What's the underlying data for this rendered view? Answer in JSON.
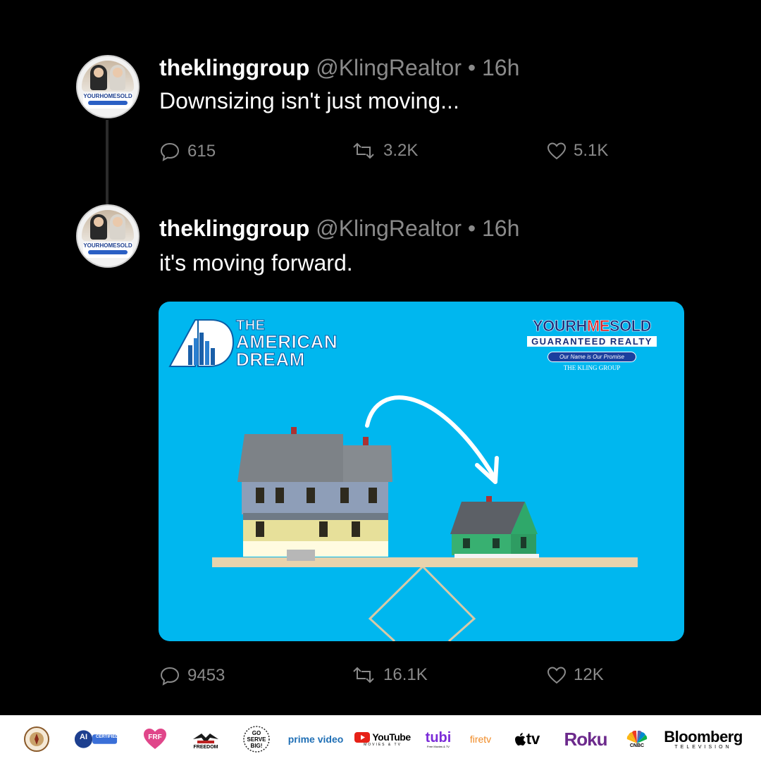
{
  "tweets": [
    {
      "display_name": "theklinggroup",
      "meta": "@KlingRealtor • 16h",
      "text": "Downsizing isn't just moving...",
      "replies": "615",
      "retweets": "3.2K",
      "likes": "5.1K"
    },
    {
      "display_name": "theklinggroup",
      "meta": "@KlingRealtor • 16h",
      "text": "it's moving forward.",
      "replies": "9453",
      "retweets": "16.1K",
      "likes": "12K"
    }
  ],
  "avatar_badge": "YOURHOMESOLD",
  "card": {
    "brand_left": [
      "THE",
      "AMERICAN",
      "DREAM"
    ],
    "brand_right": {
      "line1a": "YOURH",
      "line1b": "ME",
      "line1c": "SOLD",
      "line2": "GUARANTEED REALTY",
      "line3": "Our Name is Our Promise",
      "line4": "THE KLING GROUP"
    }
  },
  "footer": {
    "logos": [
      "AI",
      "CERTIFIED",
      "FRF",
      "FREEDOM",
      "GO SERVE BIG!",
      "prime video",
      "YouTube",
      "MOVIES & TV",
      "tubi",
      "Free Movies & TV",
      "firetv",
      "tv",
      "Roku",
      "CNBC",
      "Bloomberg",
      "TELEVISION"
    ]
  },
  "colors": {
    "background": "#000000",
    "card_blue": "#00b7ef",
    "muted": "#8a8a8a"
  }
}
